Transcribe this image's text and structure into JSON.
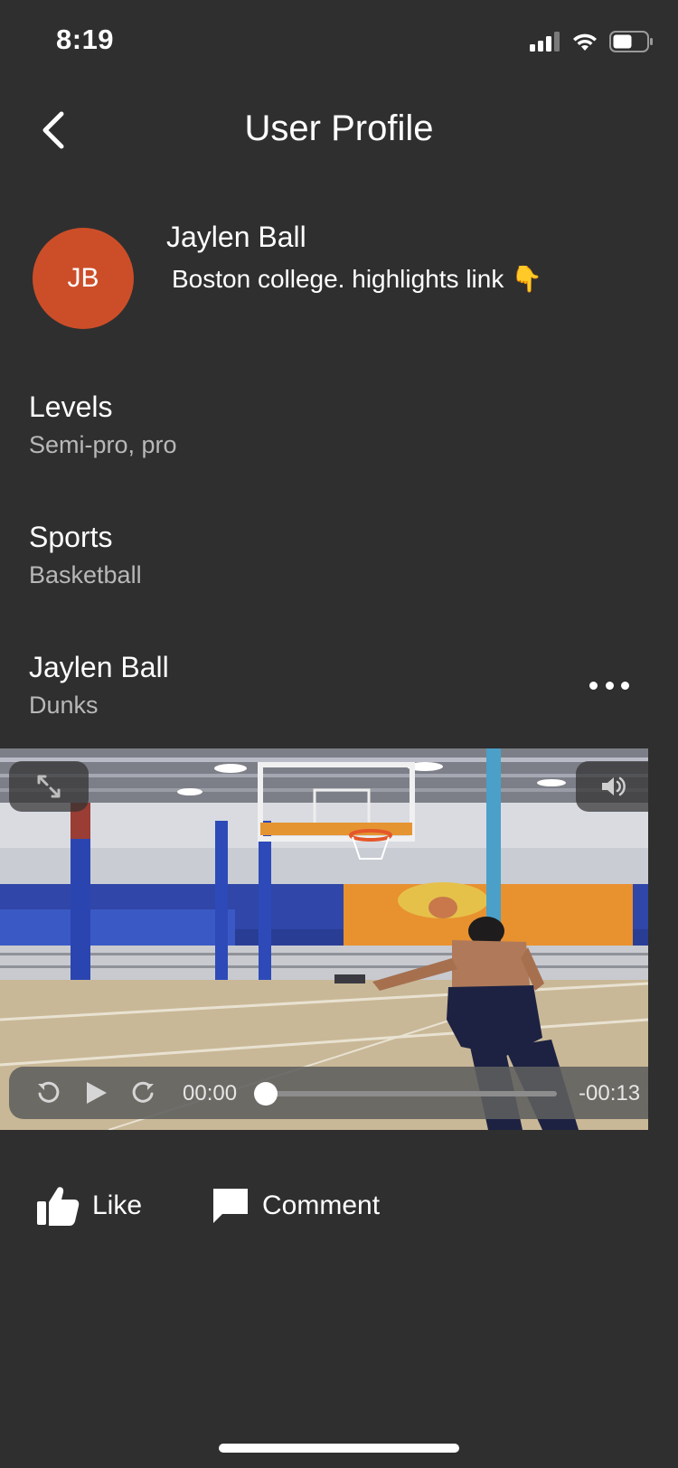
{
  "status_bar": {
    "time": "8:19"
  },
  "nav": {
    "title": "User Profile"
  },
  "profile": {
    "initials": "JB",
    "avatar_color": "#cc4e29",
    "name": "Jaylen Ball",
    "bio": "Boston college. highlights link 👇"
  },
  "levels": {
    "label": "Levels",
    "value": "Semi-pro, pro"
  },
  "sports": {
    "label": "Sports",
    "value": "Basketball"
  },
  "post": {
    "author": "Jaylen Ball",
    "caption": "Dunks"
  },
  "video": {
    "time_current": "00:00",
    "time_remaining": "-00:13",
    "progress": 0
  },
  "actions": {
    "like_label": "Like",
    "comment_label": "Comment"
  },
  "colors": {
    "background": "#2f2f2f",
    "text_secondary": "#b8b8b8"
  }
}
